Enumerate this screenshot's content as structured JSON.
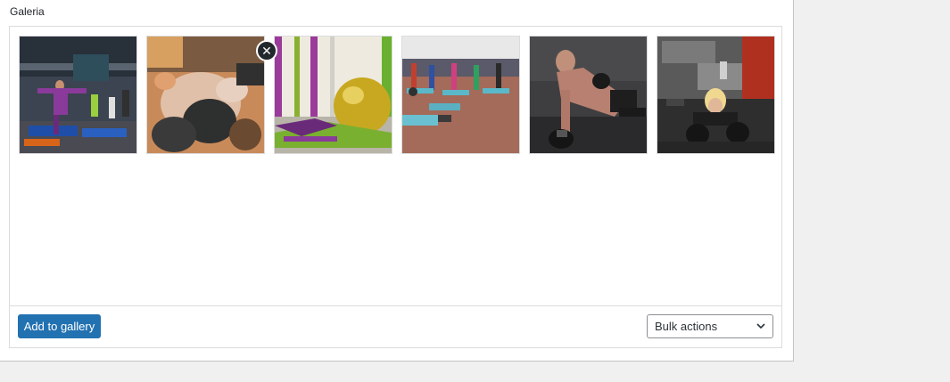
{
  "field": {
    "label": "Galeria"
  },
  "gallery": {
    "images": [
      {
        "name": "yoga-class-hall"
      },
      {
        "name": "stretching-group"
      },
      {
        "name": "fitness-ball-mats"
      },
      {
        "name": "step-aerobics-class"
      },
      {
        "name": "man-dumbbell-pushup"
      },
      {
        "name": "woman-kettlebell-pushup"
      }
    ],
    "remove_label": "✕"
  },
  "footer": {
    "add_button_label": "Add to gallery",
    "bulk_select_value": "Bulk actions"
  },
  "colors": {
    "accent": "#2271b1",
    "remove_bg": "#23282d"
  }
}
